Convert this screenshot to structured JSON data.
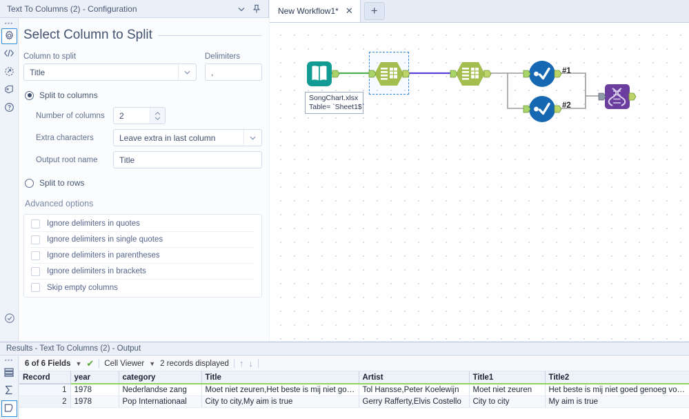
{
  "config_panel": {
    "titlebar": {
      "title": "Text To Columns (2) - Configuration",
      "collapse_icon": "chevron-down-icon",
      "pin_icon": "pin-icon"
    },
    "rail": {
      "items": [
        {
          "icon": "gear-icon",
          "name": "configuration"
        },
        {
          "icon": "code-icon",
          "name": "xml-view"
        },
        {
          "icon": "annotation-icon",
          "name": "annotation"
        },
        {
          "icon": "tag-icon",
          "name": "tag"
        },
        {
          "icon": "help-icon",
          "name": "help"
        }
      ],
      "bottom_icon": "check-circle-icon"
    },
    "heading": "Select Column to Split",
    "column_to_split": {
      "label": "Column to split",
      "value": "Title"
    },
    "delimiters": {
      "label": "Delimiters",
      "value": ","
    },
    "split_to_columns": {
      "label": "Split to columns",
      "selected": true
    },
    "number_of_columns": {
      "label": "Number of columns",
      "value": "2"
    },
    "extra_characters": {
      "label": "Extra characters",
      "value": "Leave extra in last column"
    },
    "output_root_name": {
      "label": "Output root name",
      "value": "Title"
    },
    "split_to_rows": {
      "label": "Split to rows",
      "selected": false
    },
    "advanced_options": {
      "title": "Advanced options",
      "checkboxes": [
        {
          "label": "Ignore delimiters in quotes",
          "checked": false
        },
        {
          "label": "Ignore delimiters in single quotes",
          "checked": false
        },
        {
          "label": "Ignore delimiters in parentheses",
          "checked": false
        },
        {
          "label": "Ignore delimiters in brackets",
          "checked": false
        },
        {
          "label": "Skip empty columns",
          "checked": false
        }
      ]
    }
  },
  "canvas": {
    "tab": {
      "label": "New Workflow1*",
      "close_icon": "close-icon"
    },
    "new_tab_label": "+",
    "annotation": "SongChart.xlsx\nTable= `Sheet1$`",
    "connection_labels": {
      "one": "#1",
      "two": "#2"
    },
    "tools": [
      {
        "name": "input-data-tool",
        "color": "#1a9a94"
      },
      {
        "name": "text-to-columns-tool",
        "color": "#9fb84a",
        "selected": true
      },
      {
        "name": "text-to-columns-tool-2",
        "color": "#9fb84a"
      },
      {
        "name": "select-tool-1",
        "color": "#1668b3"
      },
      {
        "name": "select-tool-2",
        "color": "#1668b3"
      },
      {
        "name": "join-multiple-tool",
        "color": "#6b3d9e"
      }
    ]
  },
  "results": {
    "title": "Results - Text To Columns (2) - Output",
    "rail": [
      {
        "icon": "table-icon",
        "name": "data-view"
      },
      {
        "icon": "sigma-icon",
        "name": "profile-view"
      },
      {
        "icon": "output-tag-icon",
        "name": "output-view"
      }
    ],
    "toolbar": {
      "fields": "6 of 6 Fields",
      "check_icon": "green-check-icon",
      "cell_viewer": "Cell Viewer",
      "records": "2 records displayed",
      "up_icon": "arrow-up-icon",
      "down_icon": "arrow-down-icon"
    },
    "grid": {
      "columns": [
        "Record",
        "year",
        "category",
        "Title",
        "Artist",
        "Title1",
        "Title2"
      ],
      "rows": [
        {
          "record": "1",
          "year": "1978",
          "category": "Nederlandse zang",
          "title": "Moet niet zeuren,Het beste is mij niet goed geno...",
          "artist": "Tol Hansse,Peter Koelewijn",
          "title1": "Moet niet zeuren",
          "title2": "Het beste is mij niet goed genoeg voor jou"
        },
        {
          "record": "2",
          "year": "1978",
          "category": "Pop Internationaal",
          "title": "City to city,My aim is true",
          "artist": "Gerry Rafferty,Elvis Costello",
          "title1": "City to city",
          "title2": "My aim is true"
        }
      ]
    }
  }
}
